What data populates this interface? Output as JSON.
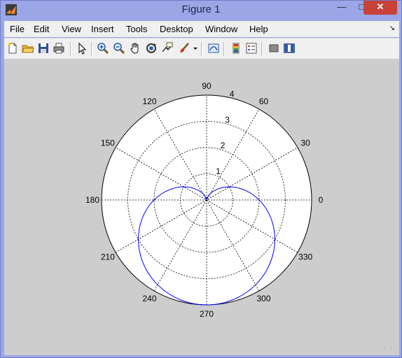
{
  "window": {
    "title": "Figure 1",
    "minimize": "—",
    "maximize": "□",
    "close": "✕"
  },
  "menu": [
    {
      "label": "File"
    },
    {
      "label": "Edit"
    },
    {
      "label": "View"
    },
    {
      "label": "Insert"
    },
    {
      "label": "Tools"
    },
    {
      "label": "Desktop"
    },
    {
      "label": "Window"
    },
    {
      "label": "Help"
    }
  ],
  "menu_arrow": "↘",
  "toolbar": [
    {
      "name": "new-figure-icon"
    },
    {
      "name": "open-file-icon"
    },
    {
      "name": "save-icon"
    },
    {
      "name": "print-icon"
    },
    {
      "name": "edit-plot-arrow-icon"
    },
    {
      "name": "zoom-in-icon"
    },
    {
      "name": "zoom-out-icon"
    },
    {
      "name": "pan-hand-icon"
    },
    {
      "name": "rotate-3d-icon"
    },
    {
      "name": "data-cursor-icon"
    },
    {
      "name": "brush-icon"
    },
    {
      "name": "link-plot-icon"
    },
    {
      "name": "insert-colorbar-icon"
    },
    {
      "name": "insert-legend-icon"
    },
    {
      "name": "hide-plot-tools-icon"
    },
    {
      "name": "show-plot-tools-icon"
    }
  ],
  "chart_data": {
    "type": "line",
    "coordinate_system": "polar",
    "title": "",
    "angle_ticks": [
      "0",
      "30",
      "60",
      "90",
      "120",
      "150",
      "180",
      "210",
      "240",
      "270",
      "300",
      "330"
    ],
    "radius_ticks": [
      "1",
      "2",
      "3",
      "4"
    ],
    "rlim": [
      0,
      4
    ],
    "grid": true,
    "series": [
      {
        "color": "#0000ff",
        "equation": "r = 2 - 2*sin(theta)",
        "theta_deg": [
          0,
          15,
          30,
          45,
          60,
          75,
          90,
          105,
          120,
          135,
          150,
          165,
          180,
          195,
          210,
          225,
          240,
          255,
          270,
          285,
          300,
          315,
          330,
          345,
          360
        ],
        "r": [
          2.0,
          1.48,
          1.0,
          0.59,
          0.27,
          0.07,
          0.0,
          0.07,
          0.27,
          0.59,
          1.0,
          1.48,
          2.0,
          2.52,
          3.0,
          3.41,
          3.73,
          3.93,
          4.0,
          3.93,
          3.73,
          3.41,
          3.0,
          2.52,
          2.0
        ]
      }
    ]
  }
}
